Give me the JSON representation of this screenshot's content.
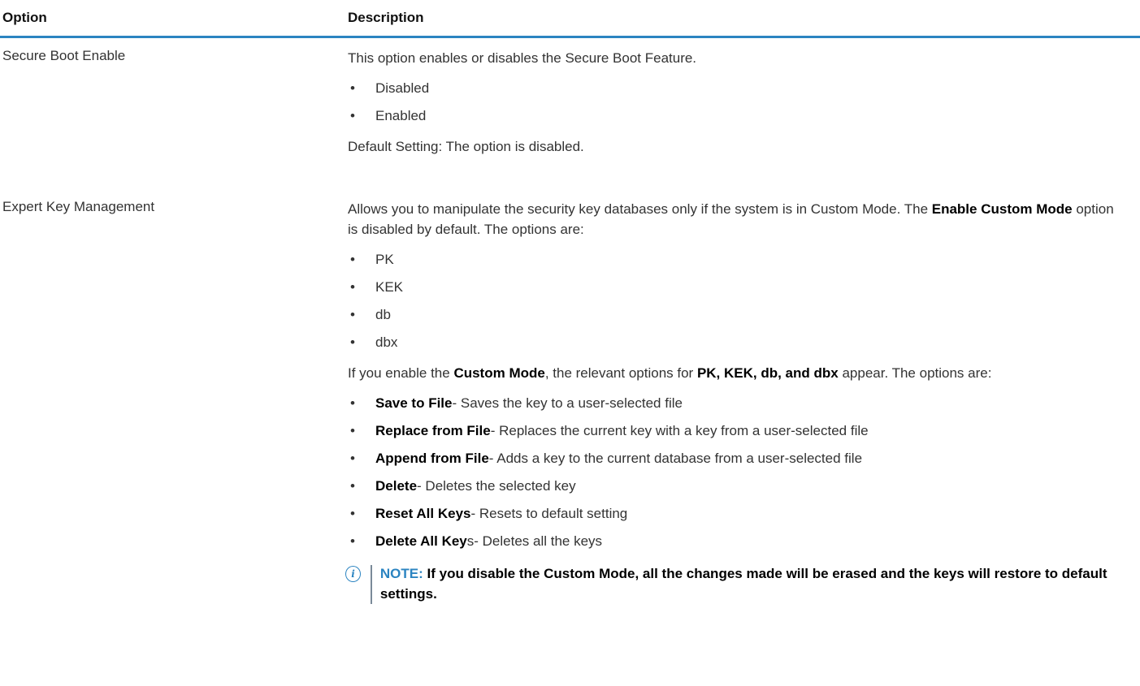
{
  "header": {
    "option": "Option",
    "description": "Description"
  },
  "rows": [
    {
      "option": "Secure Boot Enable",
      "intro": "This option enables or disables the Secure Boot Feature.",
      "bullets": [
        "Disabled",
        "Enabled"
      ],
      "footer": "Default Setting: The option is disabled."
    },
    {
      "option": "Expert Key Management",
      "intro_part1": "Allows you to manipulate the security key databases only if the system is in Custom Mode. The ",
      "intro_bold": "Enable Custom Mode",
      "intro_part2": " option is disabled by default. The options are:",
      "keys": [
        "PK",
        "KEK",
        "db",
        "dbx"
      ],
      "custom_part1": "If you enable the ",
      "custom_bold1": "Custom Mode",
      "custom_part2": ", the relevant options for ",
      "custom_bold2": "PK, KEK, db, and dbx",
      "custom_part3": " appear. The options are:",
      "actions": [
        {
          "bold": "Save to File",
          "suffix": "",
          "text": "- Saves the key to a user-selected file"
        },
        {
          "bold": "Replace from File",
          "suffix": "",
          "text": "- Replaces the current key with a key from a user-selected file"
        },
        {
          "bold": "Append from File",
          "suffix": "",
          "text": "- Adds a key to the current database from a user-selected file"
        },
        {
          "bold": "Delete",
          "suffix": "",
          "text": "- Deletes the selected key"
        },
        {
          "bold": "Reset All Keys",
          "suffix": "",
          "text": "- Resets to default setting"
        },
        {
          "bold": "Delete All Key",
          "suffix": "s",
          "text": "- Deletes all the keys"
        }
      ],
      "note_label": "NOTE:",
      "note_text": " If you disable the Custom Mode, all the changes made will be erased and the keys will restore to default settings."
    }
  ],
  "bullet_glyph": "•",
  "icons": {
    "note": "info-icon"
  },
  "colors": {
    "accent": "#2b84c1"
  }
}
